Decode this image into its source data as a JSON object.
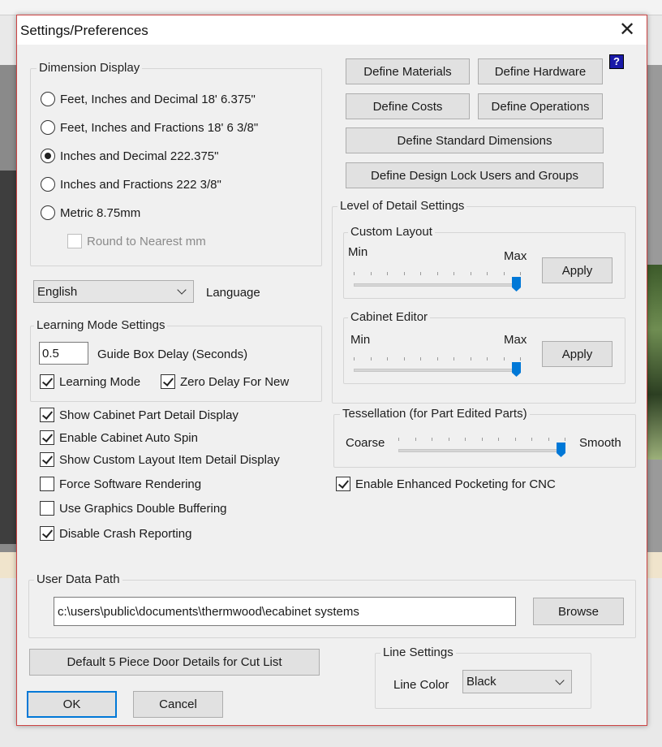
{
  "dialog": {
    "title": "Settings/Preferences",
    "close_glyph": "✕"
  },
  "dimension_display": {
    "label": "Dimension Display",
    "options": [
      {
        "label": "Feet, Inches and Decimal 18' 6.375\"",
        "selected": false
      },
      {
        "label": "Feet, Inches and Fractions 18' 6 3/8\"",
        "selected": false
      },
      {
        "label": "Inches and Decimal 222.375\"",
        "selected": true
      },
      {
        "label": "Inches and Fractions 222 3/8\"",
        "selected": false
      },
      {
        "label": "Metric 8.75mm",
        "selected": false
      }
    ],
    "round_label": "Round to Nearest mm",
    "round_checked": false
  },
  "language": {
    "selected": "English",
    "label": "Language"
  },
  "learning_mode": {
    "label": "Learning Mode Settings",
    "guide_delay_value": "0.5",
    "guide_delay_label": "Guide Box Delay (Seconds)",
    "learning_mode_label": "Learning Mode",
    "learning_mode_checked": true,
    "zero_delay_label": "Zero Delay For New",
    "zero_delay_checked": true
  },
  "options": [
    {
      "label": "Show Cabinet Part Detail Display",
      "checked": true
    },
    {
      "label": "Enable Cabinet Auto Spin",
      "checked": true
    },
    {
      "label": "Show Custom Layout Item Detail Display",
      "checked": true
    },
    {
      "label": "Force Software Rendering",
      "checked": false
    },
    {
      "label": "Use Graphics Double Buffering",
      "checked": false
    },
    {
      "label": "Disable Crash Reporting",
      "checked": true
    }
  ],
  "buttons": {
    "define_materials": "Define Materials",
    "define_hardware": "Define Hardware",
    "define_costs": "Define Costs",
    "define_operations": "Define Operations",
    "define_standard_dimensions": "Define Standard Dimensions",
    "define_design_lock": "Define Design Lock Users and Groups",
    "help": "?",
    "default_door": "Default 5 Piece Door Details for Cut List",
    "ok": "OK",
    "cancel": "Cancel",
    "browse": "Browse"
  },
  "level_of_detail": {
    "label": "Level of Detail Settings",
    "custom_layout": {
      "label": "Custom Layout",
      "min": "Min",
      "max": "Max",
      "apply": "Apply",
      "level": 1.0
    },
    "cabinet_editor": {
      "label": "Cabinet Editor",
      "min": "Min",
      "max": "Max",
      "apply": "Apply",
      "level": 1.0
    }
  },
  "tessellation": {
    "label": "Tessellation (for Part Edited Parts)",
    "coarse": "Coarse",
    "smooth": "Smooth",
    "level": 1.0
  },
  "enhanced_pocketing": {
    "label": "Enable Enhanced Pocketing for CNC",
    "checked": true
  },
  "user_data_path": {
    "label": "User Data Path",
    "value": "c:\\users\\public\\documents\\thermwood\\ecabinet systems"
  },
  "line_settings": {
    "label": "Line Settings",
    "color_label": "Line Color",
    "color_value": "Black"
  },
  "colors": {
    "accent": "#0078d7",
    "dialog_bg": "#f0f0f0",
    "border": "#c44444"
  }
}
